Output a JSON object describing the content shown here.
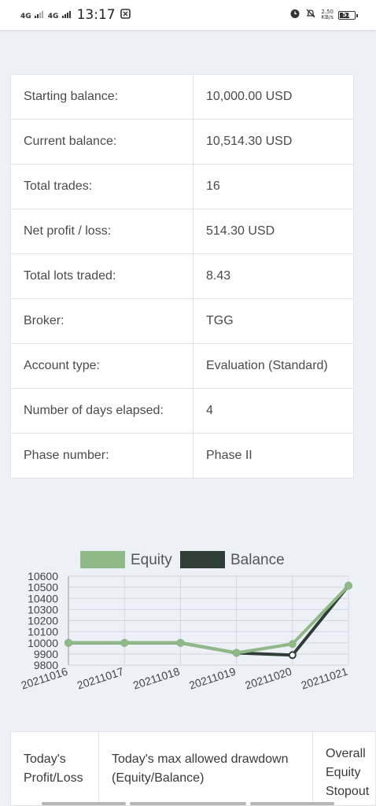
{
  "status_bar": {
    "net1": "4G",
    "net2": "4G",
    "time": "13:17",
    "net_speed_value": "2.50",
    "net_speed_unit": "KB/s",
    "battery": "51"
  },
  "info_rows": [
    {
      "label": "Starting balance:",
      "value": "10,000.00 USD"
    },
    {
      "label": "Current balance:",
      "value": "10,514.30 USD"
    },
    {
      "label": "Total trades:",
      "value": "16"
    },
    {
      "label": "Net profit / loss:",
      "value": "514.30 USD"
    },
    {
      "label": "Total lots traded:",
      "value": "8.43"
    },
    {
      "label": "Broker:",
      "value": "TGG"
    },
    {
      "label": "Account type:",
      "value": "Evaluation (Standard)"
    },
    {
      "label": "Number of days elapsed:",
      "value": "4"
    },
    {
      "label": "Phase number:",
      "value": "Phase II"
    }
  ],
  "chart_data": {
    "type": "line",
    "x": [
      "20211016",
      "20211017",
      "20211018",
      "20211019",
      "20211020",
      "20211021"
    ],
    "series": [
      {
        "name": "Equity",
        "color": "#8fba87",
        "values": [
          10000,
          10000,
          10000,
          9910,
          9990,
          10514.3
        ]
      },
      {
        "name": "Balance",
        "color": "#2f3f38",
        "values": [
          10000,
          10000,
          10000,
          9910,
          9890,
          10514.3
        ]
      }
    ],
    "yticks": [
      9800,
      9900,
      10000,
      10100,
      10200,
      10300,
      10400,
      10500,
      10600
    ],
    "ylim": [
      9800,
      10600
    ],
    "grid": true,
    "legend": "top-center"
  },
  "bottom_table": {
    "col1": "Today's Profit/Loss",
    "col2": "Today's max allowed drawdown (Equity/Balance)",
    "col3": "Overall Equity Stopout"
  }
}
